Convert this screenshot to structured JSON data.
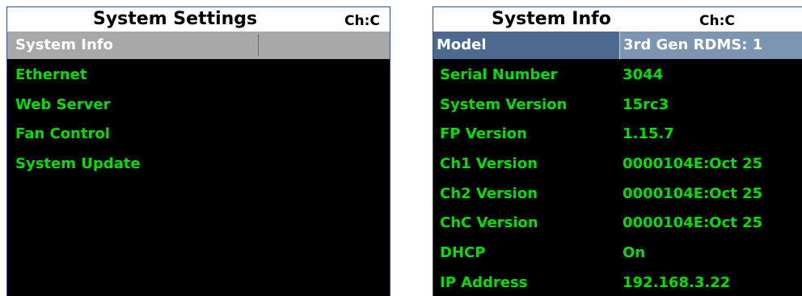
{
  "left_panel": {
    "title": "System Settings",
    "channel": "Ch:C",
    "menu": [
      {
        "label": "System Info",
        "selected": true
      },
      {
        "label": "Ethernet"
      },
      {
        "label": "Web Server"
      },
      {
        "label": "Fan Control"
      },
      {
        "label": "System Update"
      }
    ]
  },
  "right_panel": {
    "title": "System Info",
    "channel": "Ch:C",
    "rows": [
      {
        "key": "Model",
        "value": "3rd Gen RDMS: 1"
      },
      {
        "key": "Serial Number",
        "value": "3044"
      },
      {
        "key": "System Version",
        "value": "15rc3"
      },
      {
        "key": "FP Version",
        "value": "1.15.7"
      },
      {
        "key": "Ch1 Version",
        "value": "0000104E:Oct 25"
      },
      {
        "key": "Ch2 Version",
        "value": "0000104E:Oct 25"
      },
      {
        "key": "ChC Version",
        "value": "0000104E:Oct 25"
      },
      {
        "key": "DHCP",
        "value": "On"
      },
      {
        "key": "IP Address",
        "value": "192.168.3.22"
      }
    ]
  },
  "colors": {
    "background": "#000000",
    "text_green": "#00e000",
    "selection_gray": "#a8a8a8",
    "header_blue": "#4c6a8f"
  }
}
